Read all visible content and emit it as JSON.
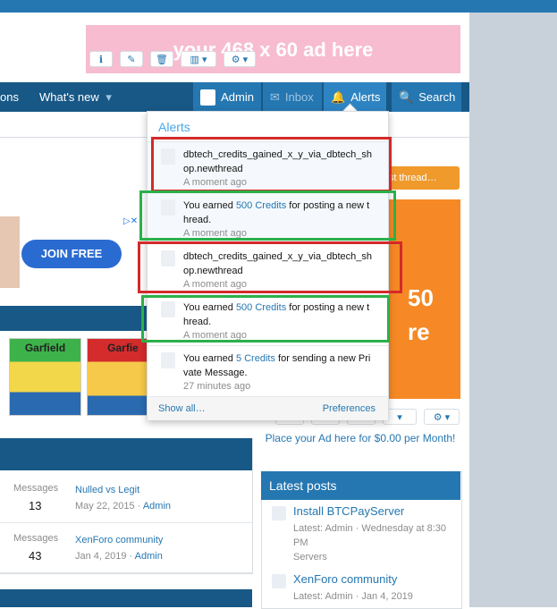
{
  "header": {
    "ad_text": "your 468 x 60 ad here"
  },
  "nav": {
    "partial_item": "ons",
    "whats_new": "What's new",
    "account": "Admin",
    "inbox": "Inbox",
    "alerts": "Alerts",
    "search": "Search"
  },
  "content": {
    "post_thread": "Post thread…",
    "join_free": "JOIN FREE",
    "sidebar_ad_line1": "50",
    "sidebar_ad_line2": "re",
    "comic1_title": "Garfield",
    "comic2_title": "Garfie",
    "place_ad": "Place your Ad here for $0.00 per Month!"
  },
  "nodes": [
    {
      "label": "Messages",
      "value": "13",
      "last_title": "Nulled vs Legit",
      "last_date": "May 22, 2015",
      "last_user": "Admin"
    },
    {
      "label": "Messages",
      "value": "43",
      "last_title": "XenForo community",
      "last_date": "Jan 4, 2019",
      "last_user": "Admin"
    }
  ],
  "latest_posts": {
    "title": "Latest posts",
    "items": [
      {
        "title": "Install BTCPayServer",
        "meta": "Latest: Admin · Wednesday at 8:30 PM",
        "forum": "Servers"
      },
      {
        "title": "XenForo community",
        "meta": "Latest: Admin · Jan 4, 2019",
        "forum": ""
      }
    ]
  },
  "alerts_menu": {
    "title": "Alerts",
    "items": [
      {
        "text": "dbtech_credits_gained_x_y_via_dbtech_shop.newthread",
        "time": "A moment ago",
        "unread": true
      },
      {
        "text_before": "You earned ",
        "link": "500 Credits",
        "text_after": " for posting a new thread.",
        "time": "A moment ago",
        "unread": true
      },
      {
        "text": "dbtech_credits_gained_x_y_via_dbtech_shop.newthread",
        "time": "A moment ago",
        "unread": false
      },
      {
        "text_before": "You earned ",
        "link": "500 Credits",
        "text_after": " for posting a new thread.",
        "time": "A moment ago",
        "unread": false
      },
      {
        "text_before": "You earned ",
        "link": "5 Credits",
        "text_after": " for sending a new Private Message.",
        "time": "27 minutes ago",
        "unread": false
      }
    ],
    "show_all": "Show all…",
    "preferences": "Preferences"
  },
  "colors": {
    "nav_bg": "#185886",
    "accent": "#2577b1",
    "highlight_red": "#d32a2a",
    "highlight_green": "#2bb04a"
  }
}
